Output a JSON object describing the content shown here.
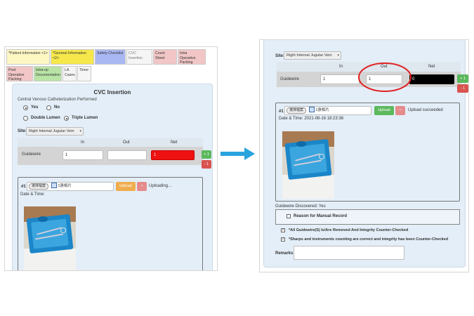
{
  "left": {
    "tabs": [
      {
        "label": "*Patient Information <1>",
        "color": "#fdf7c4"
      },
      {
        "label": "*General Information <2>",
        "color": "#f6e84b"
      },
      {
        "label": "Safety Checklist",
        "color": "#a9b8f2"
      },
      {
        "label": "CVC Insertion",
        "color": "#f5f5f5"
      },
      {
        "label": "Count Sheet",
        "color": "#f2c6c6"
      },
      {
        "label": "Intra Operative Packing",
        "color": "#f2c6c6"
      },
      {
        "label": "Post Operative Packing",
        "color": "#f2c6c6"
      },
      {
        "label": "Intra-op Documentation",
        "color": "#b9e4a6"
      },
      {
        "label": "LA Cases",
        "color": "#f5f5f5"
      },
      {
        "label": "Timer",
        "color": "#f5f5f5"
      }
    ],
    "section_title": "CVC Insertion",
    "performed_label": "Central Venous Catheterization Performed",
    "yes_label": "Yes",
    "no_label": "No",
    "double_lumen_label": "Double Lumen",
    "triple_lumen_label": "Triple Lumen",
    "site_label": "Site:",
    "site_value": "Right Internal Jugular Vein",
    "col_in": "In",
    "col_out": "Out",
    "col_net": "Net",
    "row_label": "Guidewire",
    "in_value": "1",
    "out_value": "",
    "net_value": "1",
    "plus_label": "+ 1",
    "minus_label": "- 1",
    "photo_index": "#1",
    "choose_file": "選擇檔案",
    "file_count": "1張相片",
    "upload_label": "Upload",
    "remove_label": "−",
    "status": "Uploading...",
    "datetime_label": "Date & Time:"
  },
  "right": {
    "site_label": "Site:",
    "site_value": "Right Internal Jugular Vein",
    "col_in": "In",
    "col_out": "Out",
    "col_net": "Net",
    "row_label": "Guidewire",
    "in_value": "1",
    "out_value": "1",
    "net_value": "0",
    "plus_label": "+ 1",
    "minus_label": "- 1",
    "photo_index": "#1",
    "choose_file": "選擇檔案",
    "file_count": "1張相片",
    "upload_label": "Upload",
    "remove_label": "−",
    "status": "Upload succeeded",
    "datetime": "Date & Time: 2021-08-16 18:23:36",
    "discovered": "Guidewire Discovered: Yes",
    "reason_label": "Reason for Manual Record",
    "check1": "*All Guidewire(S) Is/Are Removed And Integrity Counter-Checked",
    "check2": "*Sharps and instruments counting are correct and integrity has been Counter-Checked",
    "remarks_label": "Remarks:"
  },
  "colors": {
    "green": "#5cb85c",
    "red": "#d9534f",
    "orange": "#f0ad4e",
    "arrow": "#29a3dd",
    "net_red": "#ee1111",
    "net_black": "#000000",
    "circle": "#e02020"
  }
}
